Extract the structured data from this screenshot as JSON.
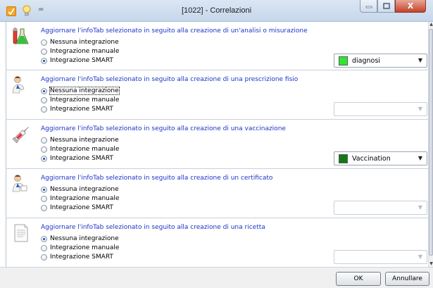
{
  "window": {
    "title": "[1022] - Correlazioni",
    "quick_access_separator": "=",
    "close_glyph": "X"
  },
  "options": {
    "none": "Nessuna integrazione",
    "manual": "Integrazione manuale",
    "smart": "Integrazione SMART"
  },
  "sections": [
    {
      "heading": "Aggiornare l'infoTab selezionato in seguito alla creazione di un'analisi o misurazione",
      "icon": "lab-flask-icon",
      "selected": "smart",
      "combo": {
        "value": "diagnosi",
        "swatch_color": "#2ee82e",
        "enabled": true
      }
    },
    {
      "heading": "Aggiornare l'infoTab selezionato in seguito alla creazione di una prescrizione fisio",
      "icon": "physio-person-icon",
      "selected": "none",
      "combo": {
        "value": "",
        "enabled": false
      }
    },
    {
      "heading": "Aggiornare l'infoTab selezionato in seguito alla creazione di una vaccinazione",
      "icon": "syringe-icon",
      "selected": "smart",
      "combo": {
        "value": "Vaccination",
        "swatch_color": "#127a12",
        "enabled": true
      }
    },
    {
      "heading": "Aggiornare l'infoTab selezionato in seguito alla creazione di un certificato",
      "icon": "doctor-certificate-icon",
      "selected": "none",
      "combo": {
        "value": "",
        "enabled": false
      }
    },
    {
      "heading": "Aggiornare l'infoTab selezionato in seguito alla creazione di una ricetta",
      "icon": "prescription-document-icon",
      "selected": "none",
      "combo": {
        "value": "",
        "enabled": false
      }
    }
  ],
  "footer": {
    "ok_label": "OK",
    "cancel_label": "Annullare"
  }
}
